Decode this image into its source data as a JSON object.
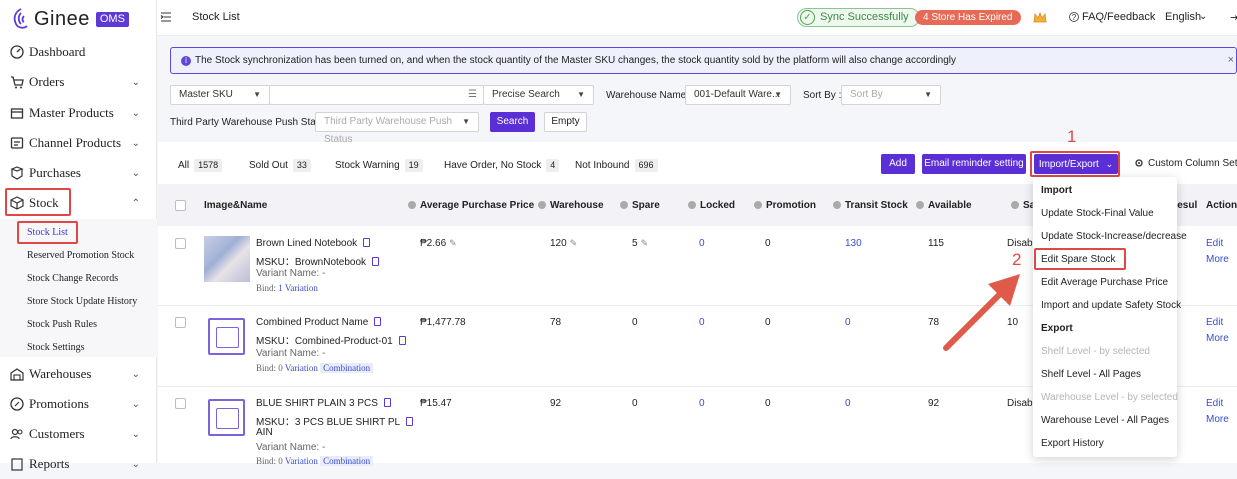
{
  "brand": {
    "name": "Ginee",
    "badge": "OMS"
  },
  "sidebar": {
    "items": [
      {
        "label": "Dashboard",
        "icon": "dashboard-icon"
      },
      {
        "label": "Orders",
        "icon": "cart-icon"
      },
      {
        "label": "Master Products",
        "icon": "box-icon"
      },
      {
        "label": "Channel Products",
        "icon": "channel-icon"
      },
      {
        "label": "Purchases",
        "icon": "purchase-icon"
      },
      {
        "label": "Stock",
        "icon": "stock-icon"
      },
      {
        "label": "Warehouses",
        "icon": "warehouse-icon"
      },
      {
        "label": "Promotions",
        "icon": "promotion-icon"
      },
      {
        "label": "Customers",
        "icon": "customers-icon"
      },
      {
        "label": "Reports",
        "icon": "reports-icon"
      }
    ],
    "stock_sub": [
      "Stock List",
      "Reserved Promotion Stock",
      "Stock Change Records",
      "Store Stock Update History",
      "Stock Push Rules",
      "Stock Settings"
    ]
  },
  "topbar": {
    "page_title": "Stock List",
    "sync": "Sync Successfully",
    "expired": "4 Store Has Expired",
    "faq": "FAQ/Feedback",
    "language": "English"
  },
  "notice": "The Stock synchronization has been turned on, and when the stock quantity of the Master SKU changes, the stock quantity sold by the platform will also change accordingly",
  "filters": {
    "search_type": "Master SKU",
    "search_value": "",
    "search_mode": "Precise Search",
    "warehouse_label": "Warehouse Name :",
    "warehouse_value": "001-Default Ware...",
    "sort_label": "Sort By :",
    "sort_placeholder": "Sort By",
    "third_party_label": "Third Party Warehouse Push Status :",
    "third_party_placeholder": "Third Party Warehouse Push Status",
    "search_btn": "Search",
    "empty_btn": "Empty"
  },
  "tabs": [
    {
      "label": "All",
      "count": "1578"
    },
    {
      "label": "Sold Out",
      "count": "33"
    },
    {
      "label": "Stock Warning",
      "count": "19"
    },
    {
      "label": "Have Order, No Stock",
      "count": "4"
    },
    {
      "label": "Not Inbound",
      "count": "696"
    }
  ],
  "actions": {
    "add": "Add",
    "email": "Email reminder setting",
    "import_export": "Import/Export",
    "custom_col": "Custom Column Setting"
  },
  "columns": [
    "Image&Name",
    "Average Purchase Price",
    "Warehouse",
    "Spare",
    "Locked",
    "Promotion",
    "Transit Stock",
    "Available",
    "Sa",
    "Resul",
    "Action"
  ],
  "rows": [
    {
      "name": "Brown Lined Notebook",
      "msku": "MSKU：BrownNotebook",
      "variant": "Variant Name: -",
      "bind": "Bind: 1 Variation",
      "bind_prefix": "Bind:",
      "bind_link": "1 Variation",
      "combo": "",
      "price": "₱2.66",
      "warehouse": "120",
      "spare": "5",
      "locked": "0",
      "promotion": "0",
      "transit": "130",
      "available": "115",
      "sa": "Disable",
      "edit": "Edit",
      "more": "More"
    },
    {
      "name": "Combined Product Name",
      "msku": "MSKU：Combined-Product-01",
      "variant": "Variant Name: -",
      "bind_prefix": "Bind: 0",
      "bind_link": "Variation",
      "combo": "Combination",
      "price": "₱1,477.78",
      "warehouse": "78",
      "spare": "0",
      "locked": "0",
      "promotion": "0",
      "transit": "0",
      "available": "78",
      "sa": "10",
      "edit": "Edit",
      "more": "More"
    },
    {
      "name": "BLUE SHIRT PLAIN 3 PCS",
      "msku": "MSKU：3 PCS BLUE SHIRT PL",
      "msku2": "AIN",
      "variant": "Variant Name: -",
      "bind_prefix": "Bind: 0",
      "bind_link": "Variation",
      "combo": "Combination",
      "price": "₱15.47",
      "warehouse": "92",
      "spare": "0",
      "locked": "0",
      "promotion": "0",
      "transit": "0",
      "available": "92",
      "sa": "Disable",
      "edit": "Edit",
      "more": "More"
    }
  ],
  "dropdown": {
    "import_header": "Import",
    "import_items": [
      "Update Stock-Final Value",
      "Update Stock-Increase/decrease",
      "Edit Spare Stock",
      "Edit Average Purchase Price",
      "Import and update Safety Stock"
    ],
    "export_header": "Export",
    "export_items": [
      "Shelf Level - by selected",
      "Shelf Level - All Pages",
      "Warehouse Level - by selected",
      "Warehouse Level - All Pages",
      "Export History"
    ]
  },
  "annotations": {
    "step1": "1",
    "step2": "2",
    "accent": "#e04848"
  }
}
